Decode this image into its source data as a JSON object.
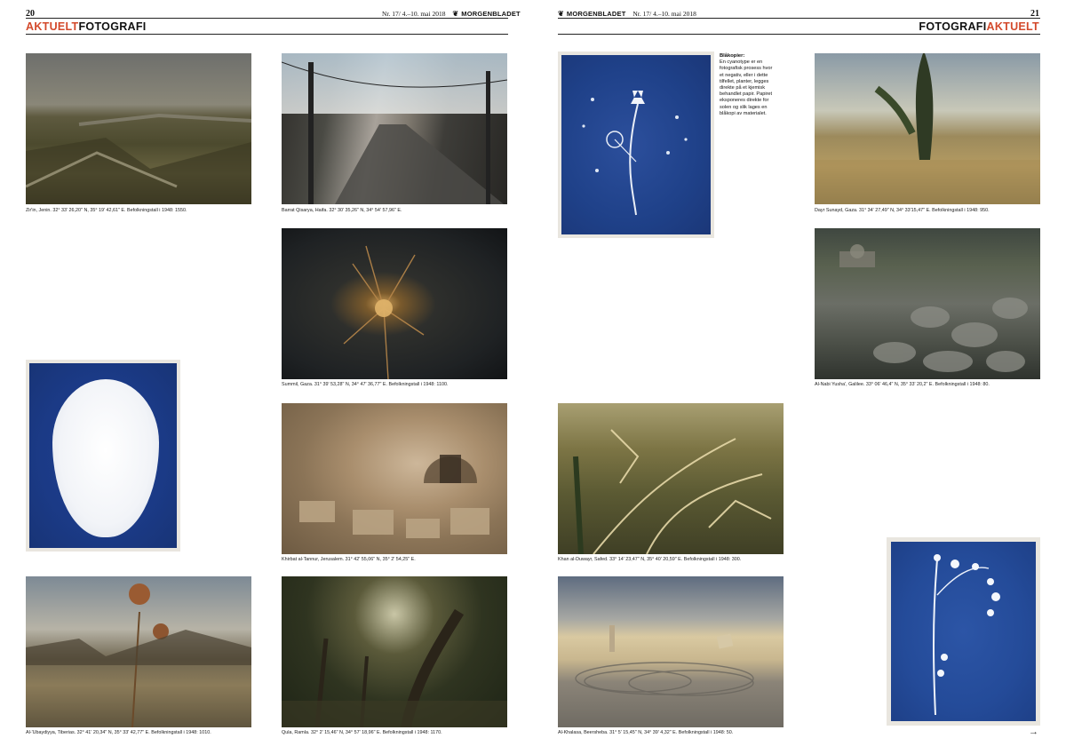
{
  "header_left": {
    "page_number": "20",
    "issue": "Nr. 17/ 4.–10. mai 2018",
    "brand": "MORGENBLADET",
    "section_accent": "AKTUELT",
    "section_title": "FOTOGRAFI"
  },
  "header_right": {
    "page_number": "21",
    "issue": "Nr. 17/ 4.–10. mai 2018",
    "brand": "MORGENBLADET",
    "section_title": "FOTOGRAFI",
    "section_accent": "AKTUELT"
  },
  "captions": {
    "zirin": "Zir'in, Jenin. 32° 33' 26,20\" N, 35° 19' 42,61\" E. Befolkningstall i 1948: 1550.",
    "barrat": "Barrat Qisarya, Haifa. 32° 30' 35,26\" N, 34° 54' 57,96\" E.",
    "summil": "Summil, Gaza. 31° 39' 53,28\" N, 34° 47' 36,77\" E. Befolkningstall i 1948: 1100.",
    "khirbat": "Khirbat al-Tannur, Jerusalem. 31° 42' 55,06\" N, 35° 2' 54,25\" E.",
    "qula": "Qula, Ramla. 32° 2' 15,46\" N, 34° 57' 18,96\" E. Befolkningstall i 1948: 1170.",
    "ubeydiyye": "Al-'Ubaydiyya, Tiberias. 32° 41' 20,34\" N, 35° 33' 42,77\" E. Befolkningstall i 1948: 1010.",
    "dayr": "Dayr Sunayd, Gaza. 31° 34' 27,49\" N, 34° 33'15,47\" E. Befolkningstall i 1948: 950.",
    "nabi": "Al-Nabi Yusha', Galilee. 33° 06' 46,4\" N, 35° 33' 20,2\" E. Befolkningstall i 1948: 80.",
    "khan": "Khan al-Duwayr, Safed. 33° 14' 23,47\" N, 35° 40' 20,59\" E. Befolkningstall i 1948: 300.",
    "khalasa": "Al-Khalasa, Beersheba. 31° 5' 15,45\" N, 34° 39' 4,32\" E. Befolkningstall i 1948: 50."
  },
  "sidebar": {
    "heading": "Blåkopier:",
    "body": "En cyanotype er en fotografisk prosess hvor et negativ, eller i dette tilfellet, planter, legges direkte på et kjemisk behandlet papir. Papiret eksponeres direkte for solen og slik lages en blåkopi av materialet."
  },
  "footer": {
    "next_arrow": "→"
  }
}
